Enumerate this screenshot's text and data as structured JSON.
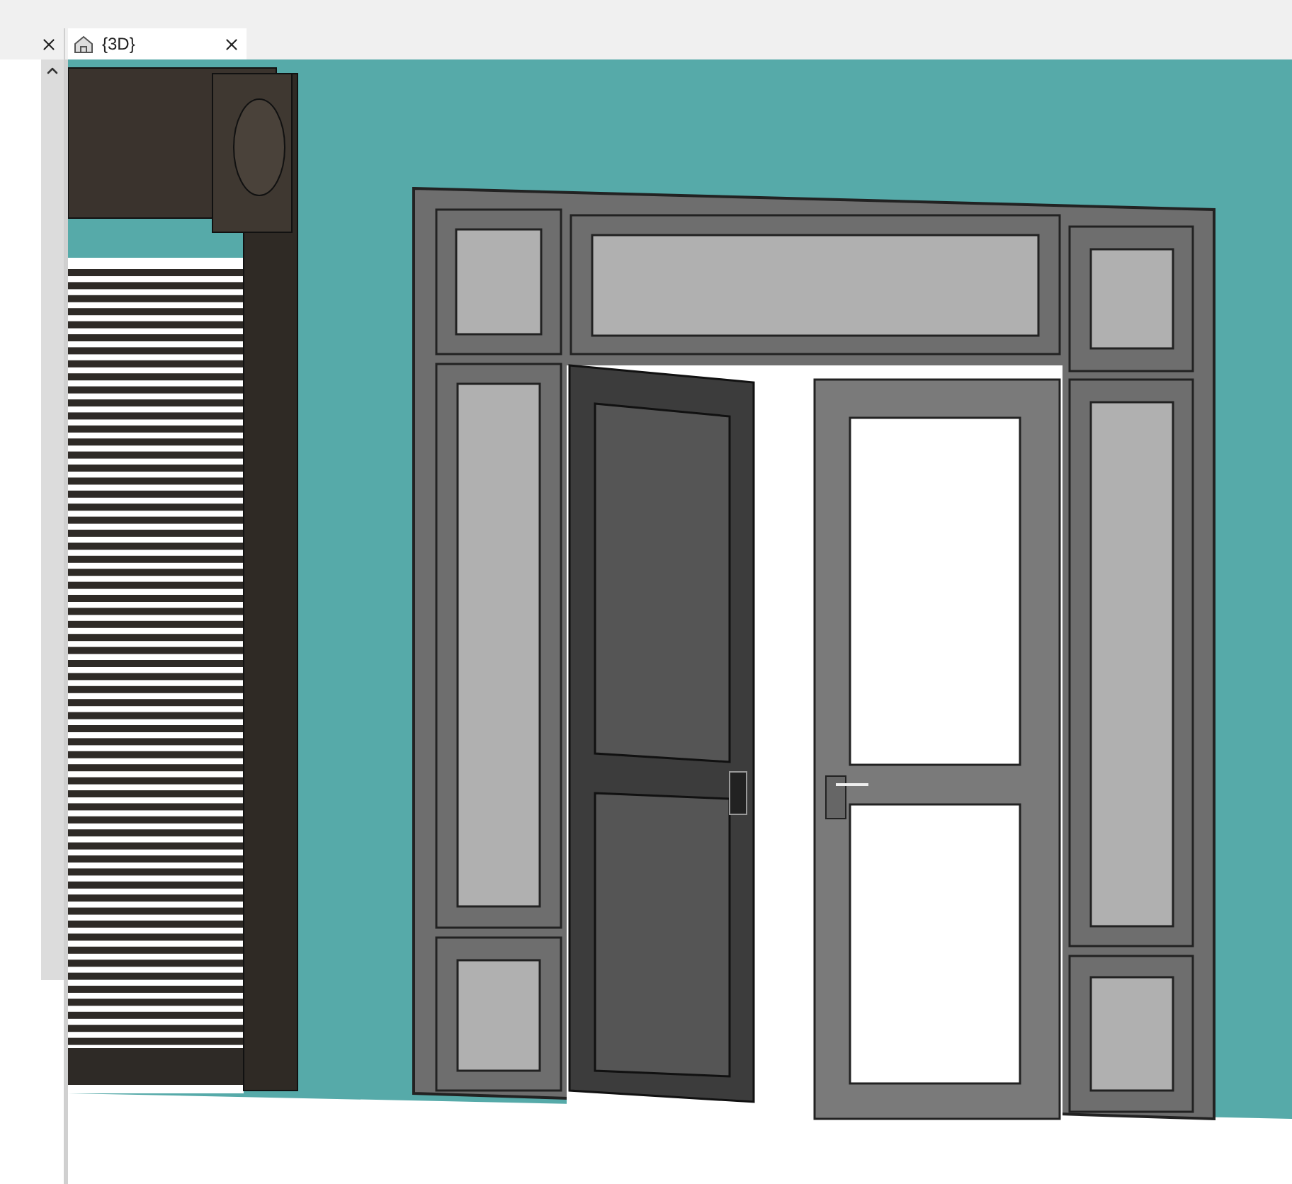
{
  "tabs": [
    {
      "label": "{3D}",
      "selected": true
    }
  ]
}
